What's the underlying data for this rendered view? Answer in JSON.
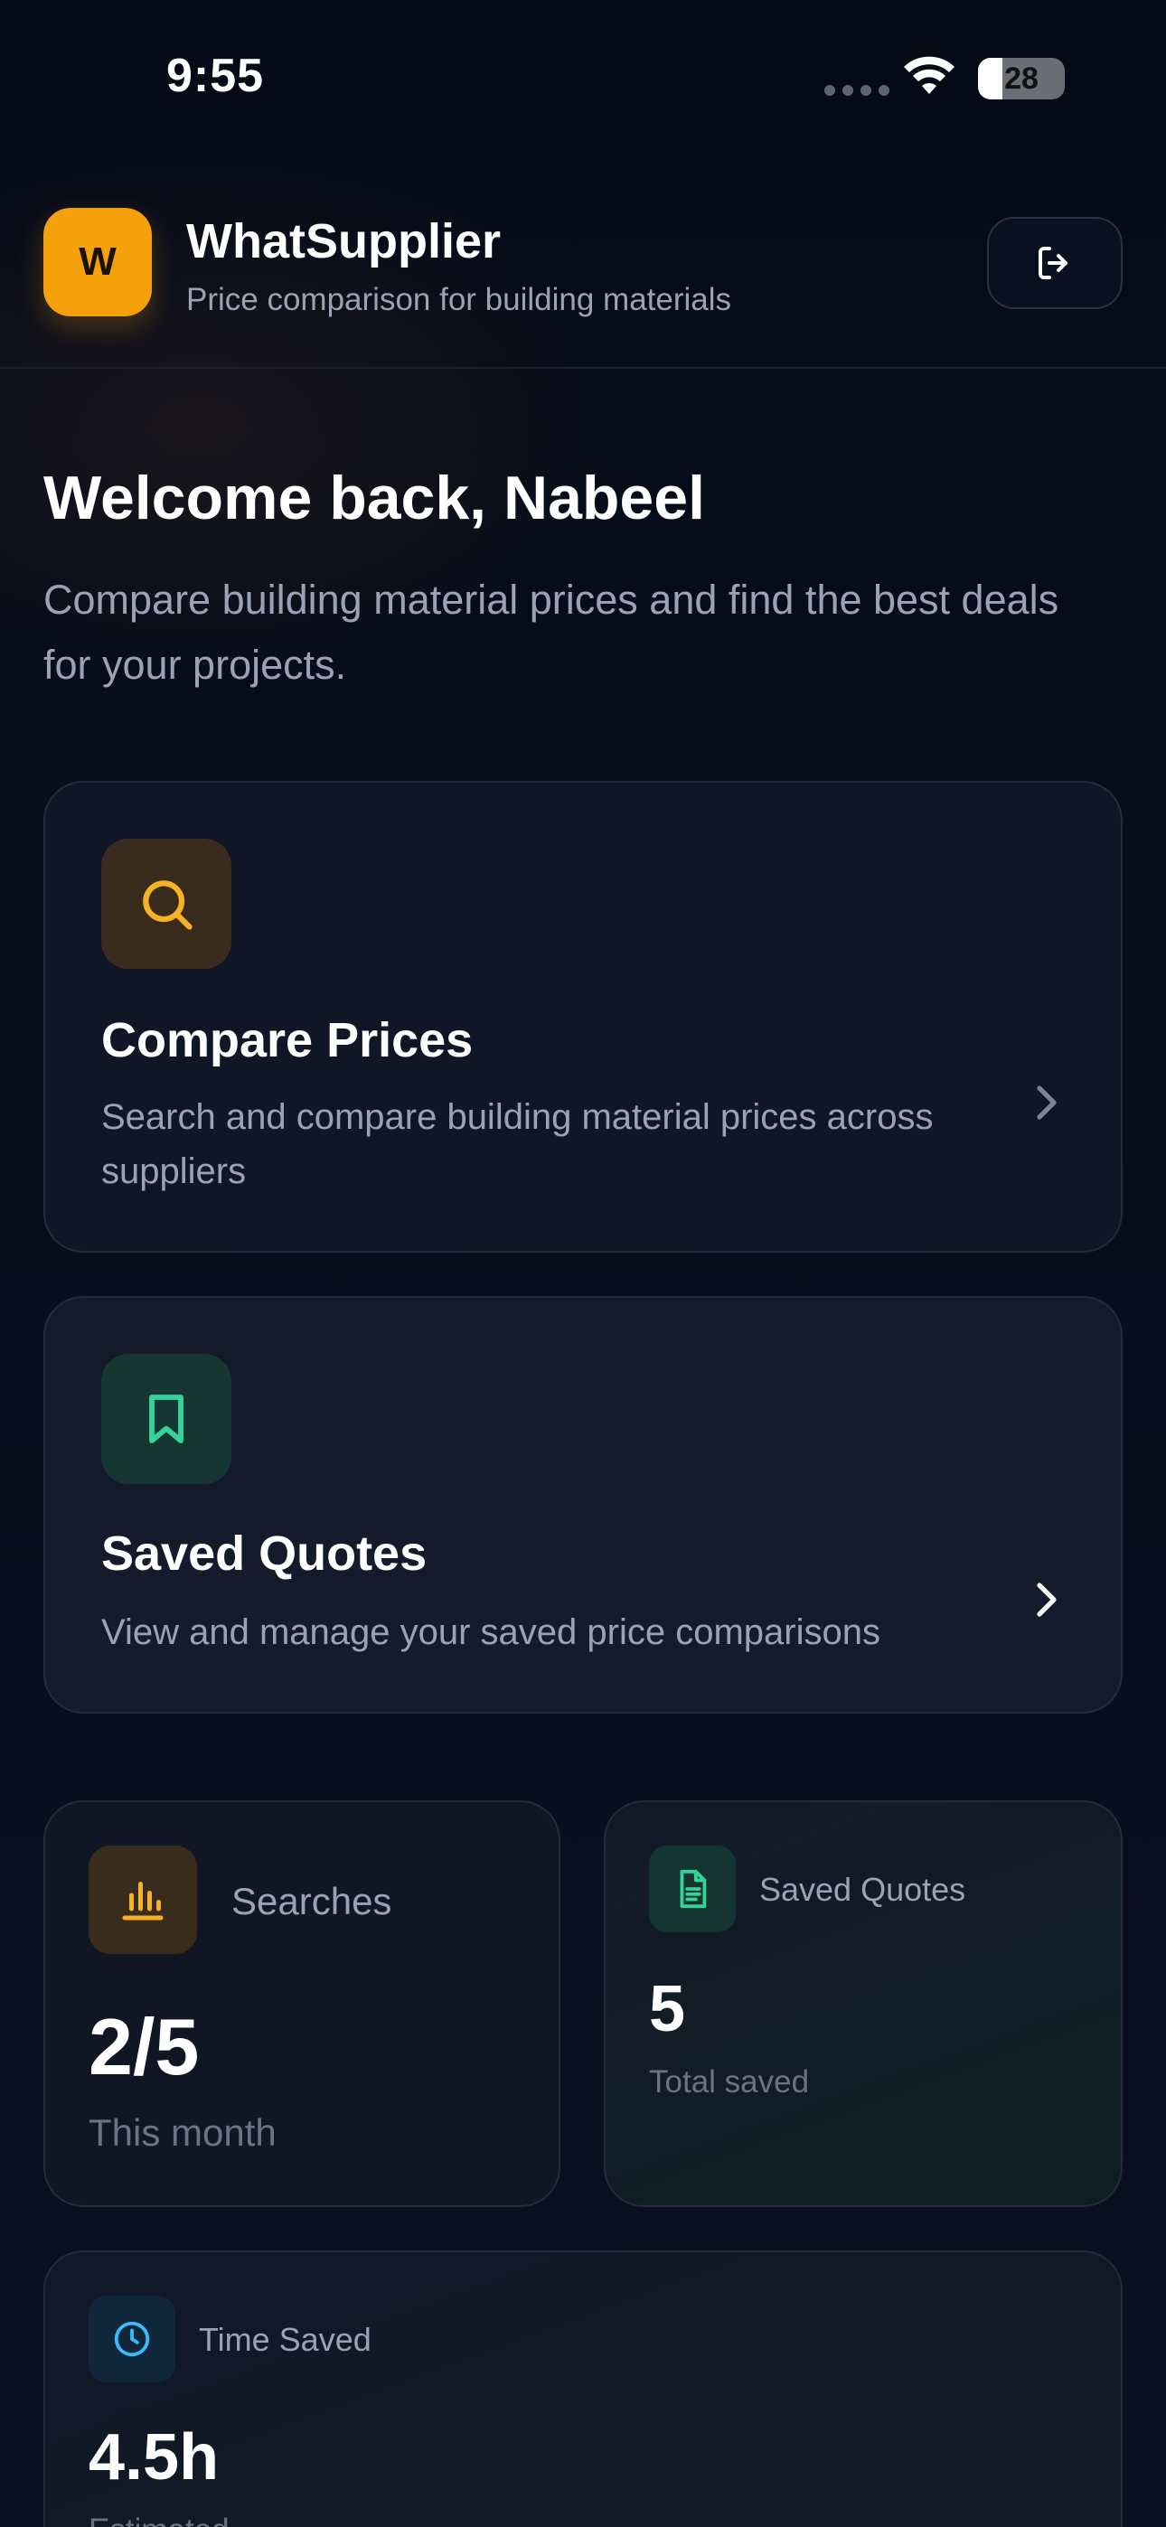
{
  "status_bar": {
    "time": "9:55",
    "battery": "28",
    "battery_level": 0.28,
    "icons": [
      "signal-icon",
      "wifi-icon",
      "battery-icon"
    ]
  },
  "header": {
    "logo_letter": "W",
    "app_name": "WhatSupplier",
    "tagline": "Price comparison for building materials",
    "logout_icon": "logout-icon"
  },
  "welcome": {
    "title": "Welcome back, Nabeel",
    "subtitle": "Compare building material prices and find the best deals for your projects."
  },
  "actions": [
    {
      "icon": "search-icon",
      "title": "Compare Prices",
      "description": "Search and compare building material prices across suppliers"
    },
    {
      "icon": "bookmark-icon",
      "title": "Saved Quotes",
      "description": "View and manage your saved price comparisons"
    }
  ],
  "stats": {
    "searches": {
      "icon": "bar-chart-icon",
      "label": "Searches",
      "value": "2/5",
      "note": "This month"
    },
    "saved_quotes": {
      "icon": "document-icon",
      "label": "Saved Quotes",
      "value": "5",
      "note": "Total saved"
    },
    "time_saved": {
      "icon": "clock-icon",
      "label": "Time Saved",
      "value": "4.5h",
      "note": "Estimated"
    }
  },
  "colors": {
    "background": "#070b18",
    "accent_amber": "#f5a10c",
    "accent_green": "#34d399",
    "accent_blue": "#38bdf8",
    "muted_text": "#9aa3b6"
  }
}
